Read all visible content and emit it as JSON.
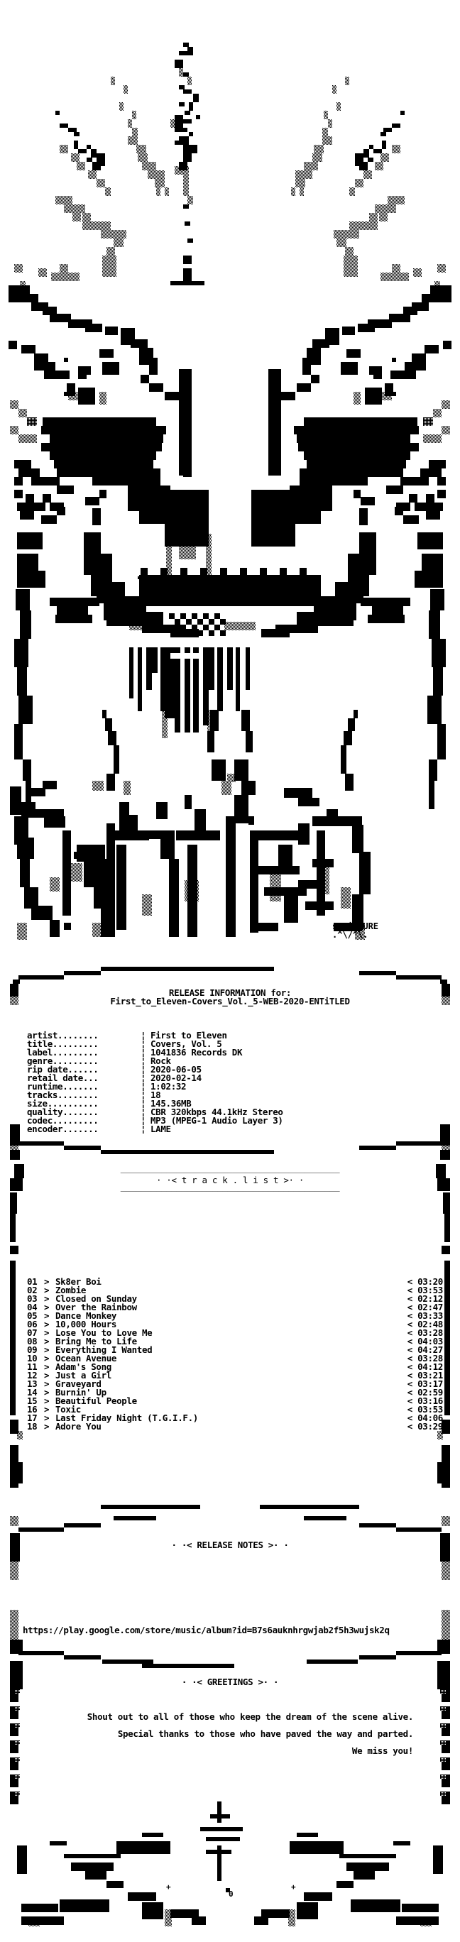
{
  "signature": {
    "name": "sM!iMPURE",
    "mark": ".^\\/^\\."
  },
  "release_info": {
    "heading": "RELEASE INFORMATION for:",
    "release_name": "First_to_Eleven-Covers_Vol._5-WEB-2020-ENTiTLED",
    "separator": "¦",
    "fields": [
      {
        "key": "artist........",
        "value": "First to Eleven"
      },
      {
        "key": "title.........",
        "value": "Covers, Vol. 5"
      },
      {
        "key": "label.........",
        "value": "1041836 Records DK"
      },
      {
        "key": "genre.........",
        "value": "Rock"
      },
      {
        "key": "rip date......",
        "value": "2020-06-05"
      },
      {
        "key": "retail date...",
        "value": "2020-02-14"
      },
      {
        "key": "runtime.......",
        "value": "1:02:32"
      },
      {
        "key": "tracks........",
        "value": "18"
      },
      {
        "key": "size..........",
        "value": "145.36MB"
      },
      {
        "key": "quality.......",
        "value": "CBR 320kbps 44.1kHz Stereo"
      },
      {
        "key": "codec.........",
        "value": "MP3 (MPEG-1 Audio Layer 3)"
      },
      {
        "key": "encoder.......",
        "value": "LAME"
      }
    ]
  },
  "tracklist": {
    "rule": "___________________________________________",
    "heading": "· ·< t r a c k . l i s t >· ·",
    "arrow": ">",
    "time_marker": "<",
    "tracks": [
      {
        "num": "01",
        "title": "Sk8er Boi",
        "time": "03:20"
      },
      {
        "num": "02",
        "title": "Zombie",
        "time": "03:53"
      },
      {
        "num": "03",
        "title": "Closed on Sunday",
        "time": "02:12"
      },
      {
        "num": "04",
        "title": "Over the Rainbow",
        "time": "02:47"
      },
      {
        "num": "05",
        "title": "Dance Monkey",
        "time": "03:33"
      },
      {
        "num": "06",
        "title": "10,000 Hours",
        "time": "02:48"
      },
      {
        "num": "07",
        "title": "Lose You to Love Me",
        "time": "03:28"
      },
      {
        "num": "08",
        "title": "Bring Me to Life",
        "time": "04:03"
      },
      {
        "num": "09",
        "title": "Everything I Wanted",
        "time": "04:27"
      },
      {
        "num": "10",
        "title": "Ocean Avenue",
        "time": "03:28"
      },
      {
        "num": "11",
        "title": "Adam's Song",
        "time": "04:12"
      },
      {
        "num": "12",
        "title": "Just a Girl",
        "time": "03:21"
      },
      {
        "num": "13",
        "title": "Graveyard",
        "time": "03:17"
      },
      {
        "num": "14",
        "title": "Burnin' Up",
        "time": "02:59"
      },
      {
        "num": "15",
        "title": "Beautiful People",
        "time": "03:16"
      },
      {
        "num": "16",
        "title": "Toxic",
        "time": "03:53"
      },
      {
        "num": "17",
        "title": "Last Friday Night (T.G.I.F.)",
        "time": "04:06"
      },
      {
        "num": "18",
        "title": "Adore You",
        "time": "03:29"
      }
    ]
  },
  "release_notes": {
    "heading": "· ·< RELEASE NOTES >· ·",
    "url": "https://play.google.com/store/music/album?id=B7s6auknhrgwjab2f5h3wujsk2q"
  },
  "greetings": {
    "heading": "· ·< GREETINGS >· ·",
    "lines": [
      "Shout out to all of those who keep the dream of the scene alive.",
      "Special thanks to those who have paved the way and parted.",
      "We miss you!"
    ]
  },
  "footer_art": {
    "small_marks": [
      "+",
      "0",
      "+"
    ]
  }
}
